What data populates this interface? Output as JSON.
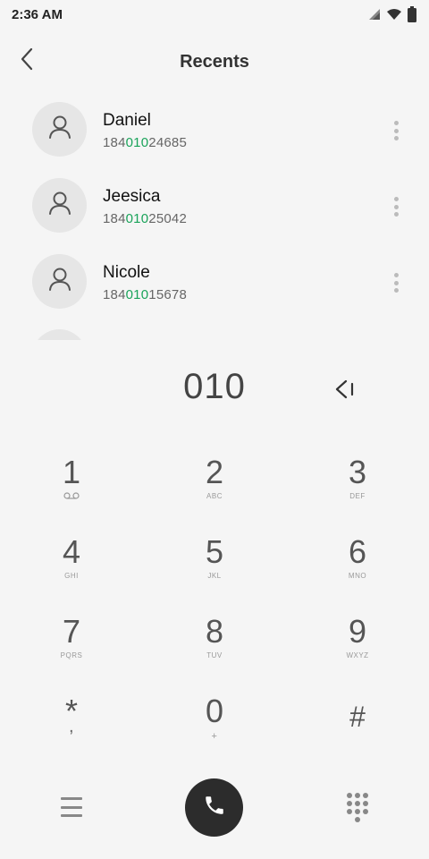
{
  "status_bar": {
    "time": "2:36 AM",
    "icons": [
      "signal-icon",
      "wifi-icon",
      "battery-icon"
    ]
  },
  "header": {
    "title": "Recents",
    "back_icon": "back-arrow-icon"
  },
  "contacts": [
    {
      "name": "Daniel",
      "number_prefix": "184",
      "number_match": "010",
      "number_suffix": "24685"
    },
    {
      "name": "Jeesica",
      "number_prefix": "184",
      "number_match": "010",
      "number_suffix": "25042"
    },
    {
      "name": "Nicole",
      "number_prefix": "184",
      "number_match": "010",
      "number_suffix": "15678"
    }
  ],
  "dialer": {
    "input": "010",
    "backspace_icon": "backspace-icon"
  },
  "keypad": [
    {
      "digit": "1",
      "sub": ""
    },
    {
      "digit": "2",
      "sub": "ABC"
    },
    {
      "digit": "3",
      "sub": "DEF"
    },
    {
      "digit": "4",
      "sub": "GHI"
    },
    {
      "digit": "5",
      "sub": "JKL"
    },
    {
      "digit": "6",
      "sub": "MNO"
    },
    {
      "digit": "7",
      "sub": "PQRS"
    },
    {
      "digit": "8",
      "sub": "TUV"
    },
    {
      "digit": "9",
      "sub": "WXYZ"
    },
    {
      "digit": "*",
      "sub": ","
    },
    {
      "digit": "0",
      "sub": "+"
    },
    {
      "digit": "#",
      "sub": ""
    }
  ],
  "bottom_bar": {
    "menu_icon": "menu-icon",
    "call_icon": "phone-icon",
    "dialpad_icon": "dialpad-icon"
  },
  "colors": {
    "match_highlight": "#1aa35a",
    "call_button": "#2c2c2c",
    "background": "#f5f5f5"
  }
}
